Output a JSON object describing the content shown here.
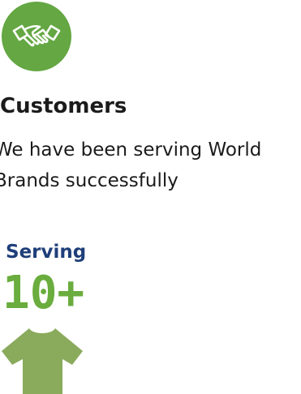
{
  "feature": {
    "icon": "handshake-icon",
    "icon_color": "#64a743",
    "title": "Customers",
    "description": "We have been serving World Brands successfully"
  },
  "stat": {
    "label": "Serving",
    "value": "10+",
    "icon": "tshirt-icon",
    "label_color": "#1f3f7a",
    "value_color": "#6aad3e",
    "icon_color": "#8aaa5c"
  }
}
